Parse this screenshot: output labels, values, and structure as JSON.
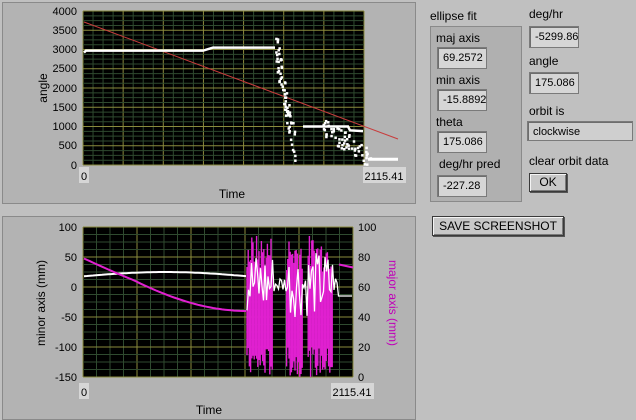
{
  "plot1": {
    "ylabel": "angle",
    "xlabel": "Time",
    "y_ticks": [
      "4000",
      "3500",
      "3000",
      "2500",
      "2000",
      "1500",
      "1000",
      "500",
      "0"
    ],
    "x_min": "0",
    "x_max": "2115.41"
  },
  "plot2": {
    "ylabel_left": "minor axis (mm)",
    "ylabel_right": "major axis (mm)",
    "xlabel": "Time",
    "left_ticks": [
      "100",
      "50",
      "0",
      "-50",
      "-100",
      "-150"
    ],
    "right_ticks": [
      "100",
      "80",
      "60",
      "40",
      "20",
      "0"
    ],
    "x_min": "0",
    "x_max": "2115.41"
  },
  "ellipse_fit": {
    "title": "ellipse fit",
    "maj_axis_label": "maj axis",
    "maj_axis_value": "69.2572",
    "min_axis_label": "min axis",
    "min_axis_value": "-15.8892",
    "theta_label": "theta",
    "theta_value": "175.086",
    "deg_hr_pred_label": "deg/hr pred",
    "deg_hr_pred_value": "-227.28"
  },
  "right": {
    "deg_hr_label": "deg/hr",
    "deg_hr_value": "-5299.86",
    "angle_label": "angle",
    "angle_value": "175.086",
    "orbit_label": "orbit is",
    "orbit_value": "clockwise",
    "clear_label": "clear orbit data",
    "ok_label": "OK"
  },
  "save_button_label": "SAVE SCREENSHOT",
  "colors": {
    "plot_bg": "#000000",
    "grid_major": "#8a8a3c",
    "grid_minor": "#2f4a2f",
    "trace_white": "#ffffff",
    "trace_red": "#c83c3c",
    "trace_magenta": "#e020d0"
  }
}
